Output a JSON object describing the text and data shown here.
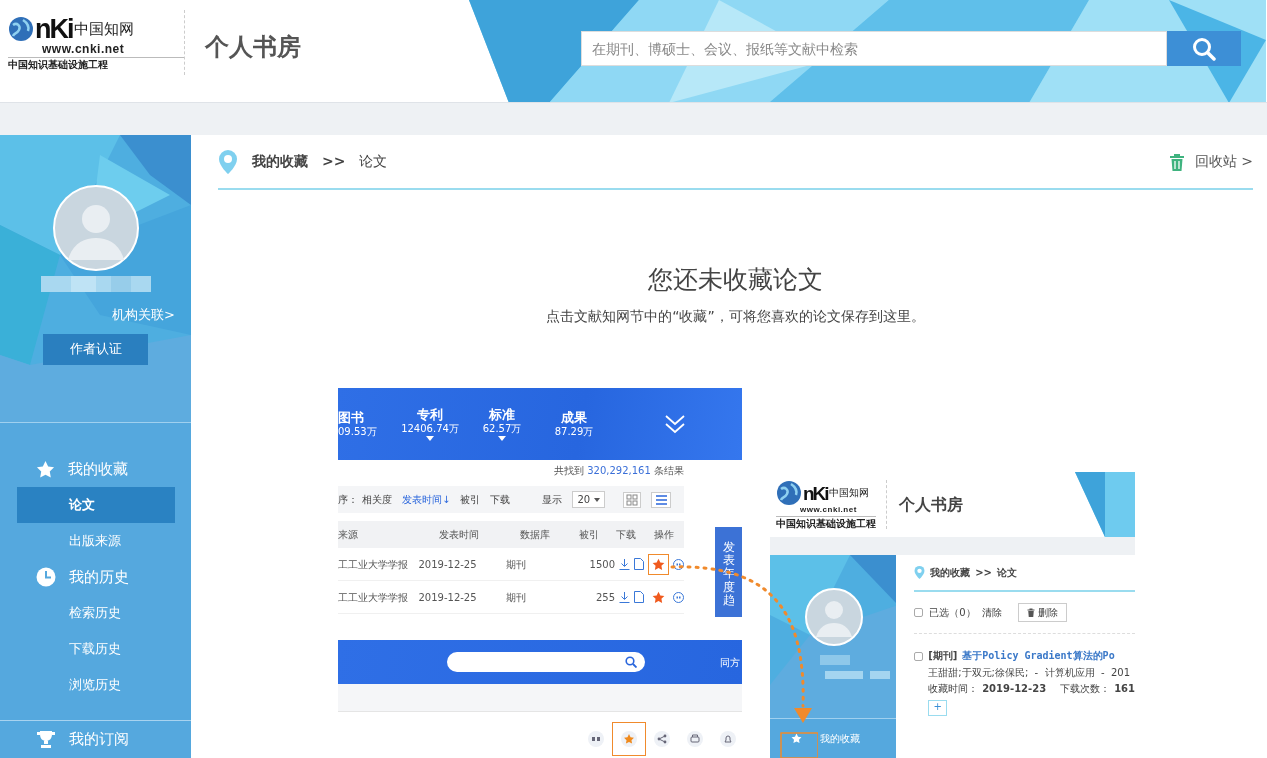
{
  "header": {
    "logo": {
      "mark": "nKi",
      "name": "中国知网",
      "url": "www.cnki.net",
      "tagline": "中国知识基础设施工程"
    },
    "title": "个人书房",
    "search": {
      "placeholder": "在期刊、博硕士、会议、报纸等文献中检索"
    }
  },
  "sidebar": {
    "org_link": "机构关联>",
    "verify_button": "作者认证",
    "sections": [
      {
        "kind": "star",
        "label": "我的收藏",
        "items": [
          {
            "label": "论文",
            "selected": true
          },
          {
            "label": "出版来源",
            "selected": false
          }
        ]
      },
      {
        "kind": "clock",
        "label": "我的历史",
        "items": [
          {
            "label": "检索历史",
            "selected": false
          },
          {
            "label": "下载历史",
            "selected": false
          },
          {
            "label": "浏览历史",
            "selected": false
          }
        ]
      },
      {
        "kind": "trophy",
        "label": "我的订阅"
      }
    ]
  },
  "breadcrumb": {
    "items": [
      "我的收藏",
      "论文"
    ],
    "separator": ">>"
  },
  "recycle_link": "回收站 >",
  "empty_state": {
    "title": "您还未收藏论文",
    "hint": "点击文献知网节中的“收藏”，可将您喜欢的论文保存到这里。"
  },
  "illustration": {
    "results_page": {
      "categories": [
        {
          "label": "图书",
          "count": "09.53万",
          "caret": false
        },
        {
          "label": "专利",
          "count": "12406.74万",
          "caret": true
        },
        {
          "label": "标准",
          "count": "62.57万",
          "caret": true
        },
        {
          "label": "成果",
          "count": "87.29万",
          "caret": false
        }
      ],
      "result_count": {
        "prefix": "共找到",
        "count": "320,292,161",
        "suffix": "条结果"
      },
      "sort": {
        "label": "序：",
        "options": [
          {
            "label": "相关度",
            "selected": false
          },
          {
            "label": "发表时间↓",
            "selected": true
          },
          {
            "label": "被引",
            "selected": false
          },
          {
            "label": "下载",
            "selected": false
          }
        ],
        "display_label": "显示",
        "page_size": "20"
      },
      "columns": [
        "来源",
        "发表时间",
        "数据库",
        "被引",
        "下载",
        "操作"
      ],
      "rows": [
        {
          "source": "工工业大学学报",
          "date": "2019-12-25",
          "database": "期刊",
          "downloads": "1500",
          "highlighted": true
        },
        {
          "source": "工工业大学学报",
          "date": "2019-12-25",
          "database": "期刊",
          "downloads": "255",
          "highlighted": false
        }
      ],
      "side_tab": "发表年度趋",
      "footer_text": "同方",
      "toolbar": [
        {
          "kind": "quote",
          "highlighted": false
        },
        {
          "kind": "star",
          "highlighted": true
        },
        {
          "kind": "share",
          "highlighted": false
        },
        {
          "kind": "print",
          "highlighted": false
        },
        {
          "kind": "bell",
          "highlighted": false
        }
      ]
    },
    "library_page": {
      "logo": {
        "mark": "nKi",
        "name": "中国知网",
        "url": "www.cnki.net",
        "tagline": "中国知识基础设施工程"
      },
      "title": "个人书房",
      "breadcrumb": {
        "items": [
          "我的收藏",
          "论文"
        ],
        "separator": ">>"
      },
      "select_all_checked": false,
      "selected_count": "已选（0）",
      "clear": "清除",
      "delete_button": "删除",
      "entry": {
        "checked": false,
        "type": "[期刊]",
        "title": "基于Policy Gradient算法的Po",
        "meta": "王甜甜;于双元;徐保民;  -  计算机应用  -  201",
        "saved_label": "收藏时间：",
        "saved_date": "2019-12-23",
        "downloads_label": "下载次数：",
        "downloads": "161",
        "add_button": "+"
      },
      "nav_item": "我的收藏"
    }
  }
}
